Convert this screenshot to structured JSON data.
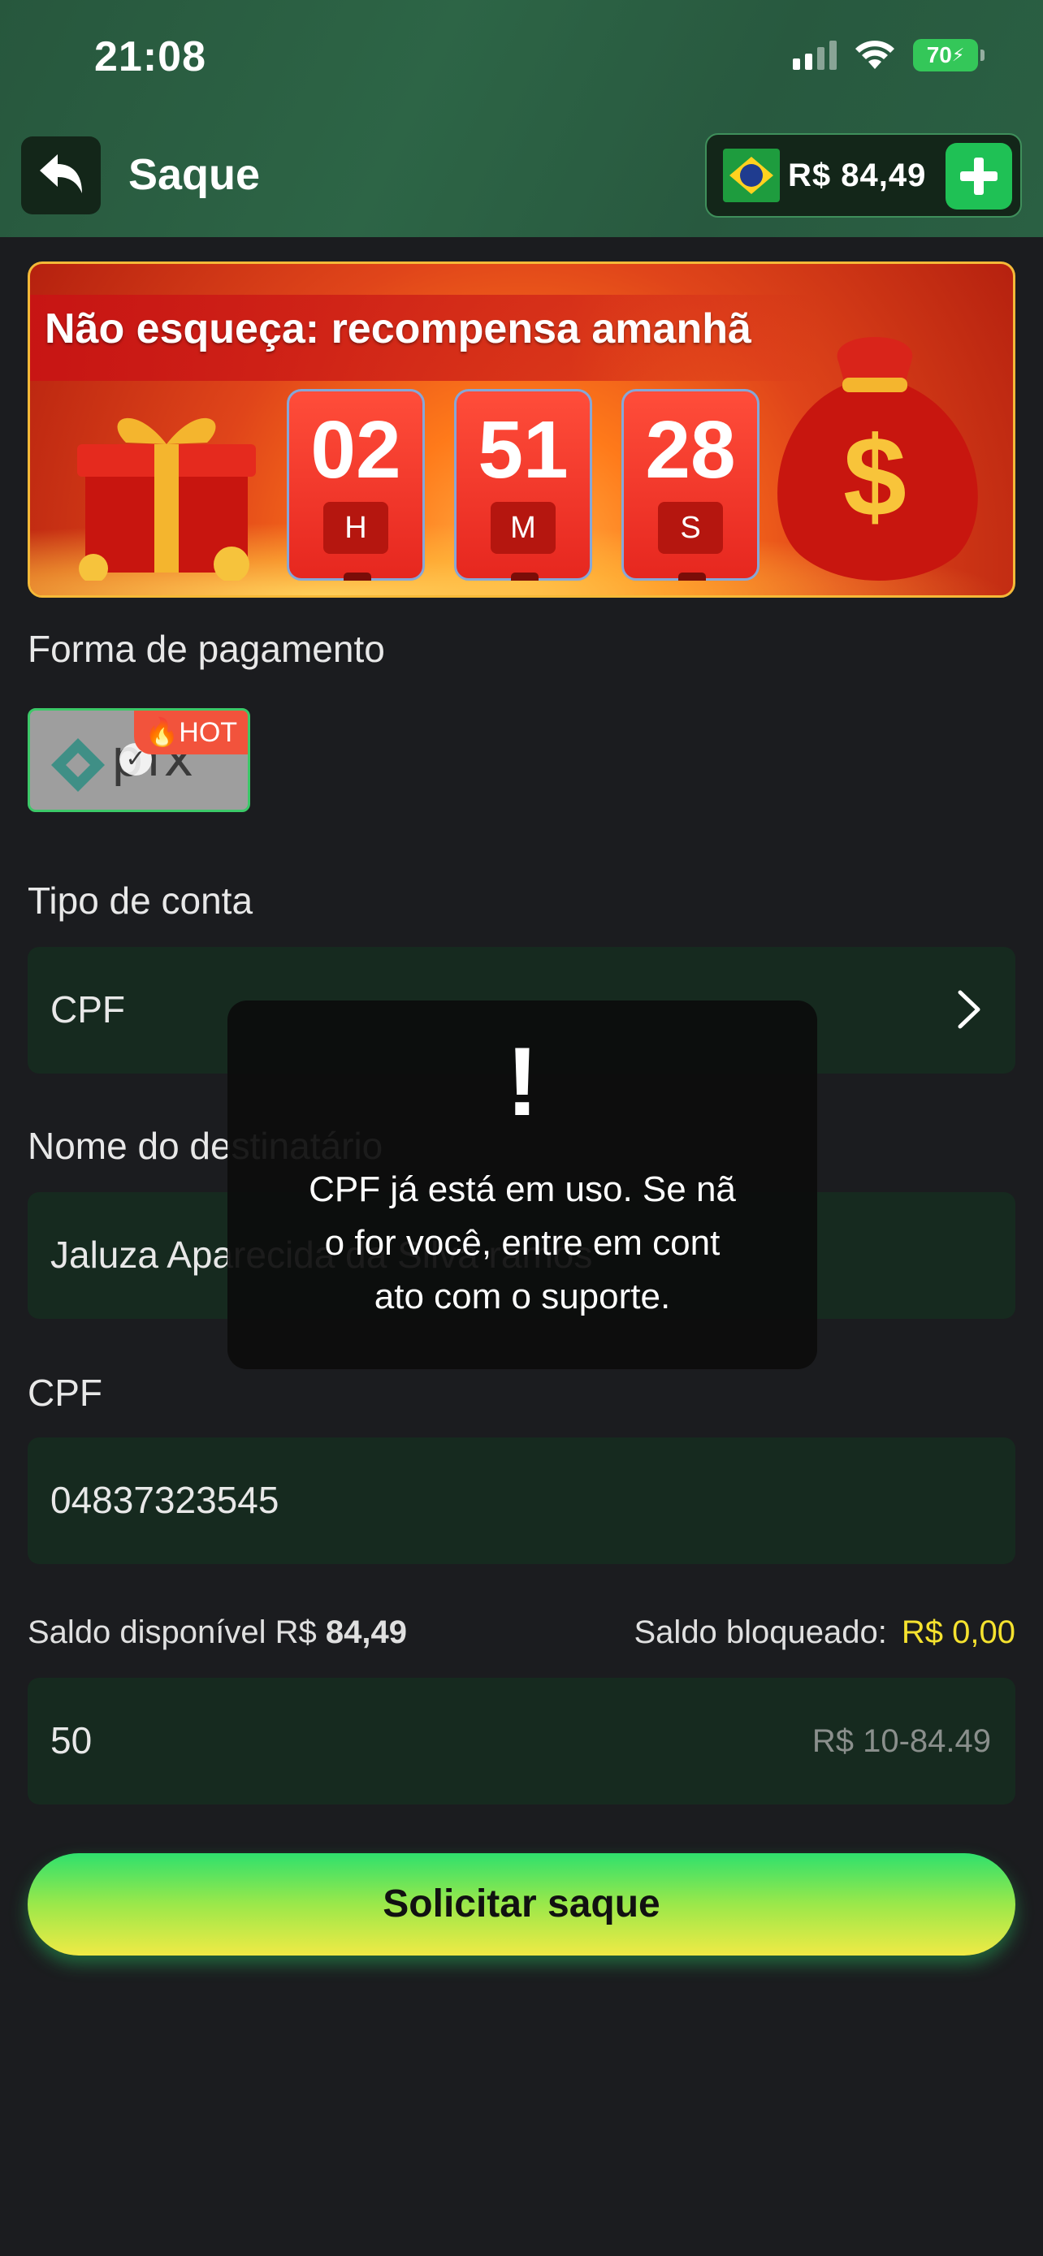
{
  "status_bar": {
    "time": "21:08",
    "battery": "70"
  },
  "header": {
    "title": "Saque",
    "balance": "R$ 84,49"
  },
  "banner": {
    "title": "Não esqueça: recompensa amanhã",
    "timer": [
      {
        "value": "02",
        "unit": "H"
      },
      {
        "value": "51",
        "unit": "M"
      },
      {
        "value": "28",
        "unit": "S"
      }
    ]
  },
  "payment": {
    "label": "Forma de pagamento",
    "method": "pix",
    "badge": "HOT"
  },
  "account_type": {
    "label": "Tipo de conta",
    "value": "CPF"
  },
  "recipient": {
    "label": "Nome do destinatário",
    "value": "Jaluza Aparecida da Silva ramos"
  },
  "cpf": {
    "label": "CPF",
    "value": "04837323545"
  },
  "saldo": {
    "available_label": "Saldo disponível R$",
    "available_value": "84,49",
    "blocked_label": "Saldo bloqueado:",
    "blocked_value": "R$ 0,00"
  },
  "amount": {
    "value": "50",
    "hint": "R$ 10-84.49"
  },
  "submit_label": "Solicitar saque",
  "toast": {
    "icon": "!",
    "lines": [
      "CPF já está em uso. Se nã",
      "o for você, entre em cont",
      "ato com o suporte."
    ]
  },
  "colors": {
    "accent": "#1fc155",
    "header": "#2d6546",
    "field": "#162a1f",
    "blocked": "#f5e22f"
  }
}
